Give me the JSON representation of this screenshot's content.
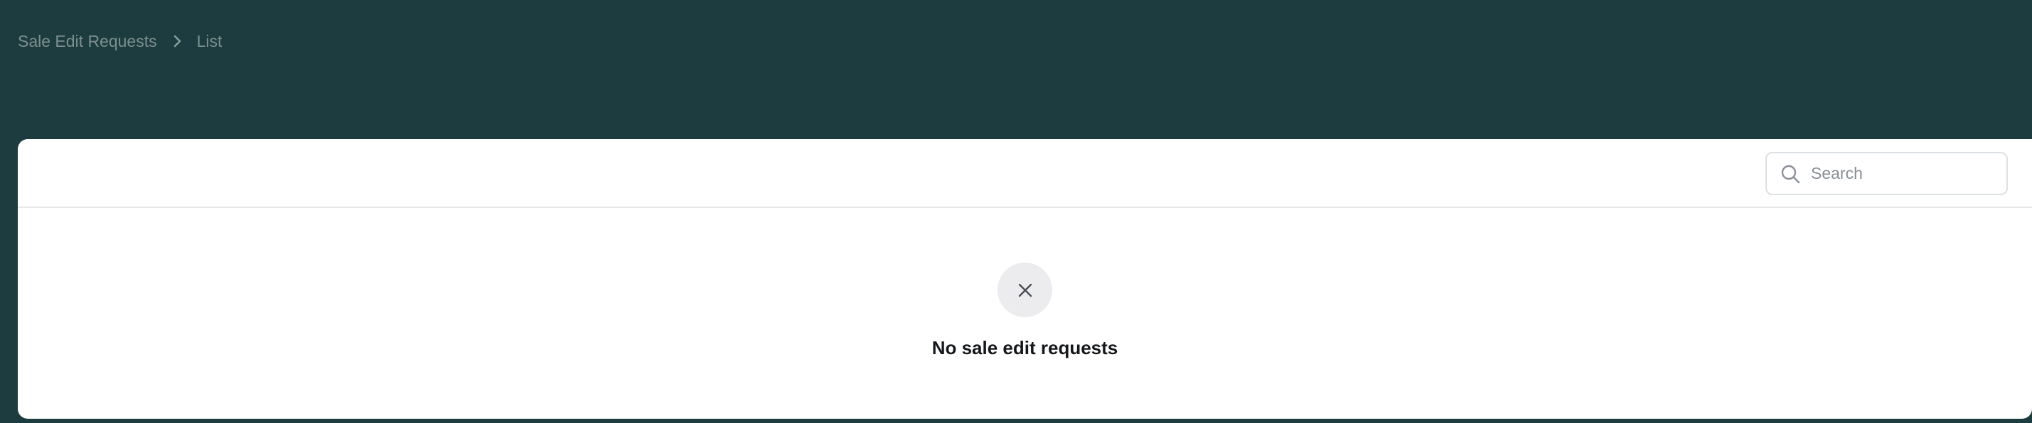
{
  "breadcrumb": {
    "parent": "Sale Edit Requests",
    "current": "List"
  },
  "search": {
    "placeholder": "Search",
    "value": ""
  },
  "empty_state": {
    "title": "No sale edit requests"
  },
  "icons": {
    "separator": "chevron-right-icon",
    "search": "search-icon",
    "empty": "x-icon"
  },
  "colors": {
    "background": "#1d3c3f",
    "card": "#ffffff",
    "muted_text": "#7d8f8f"
  }
}
